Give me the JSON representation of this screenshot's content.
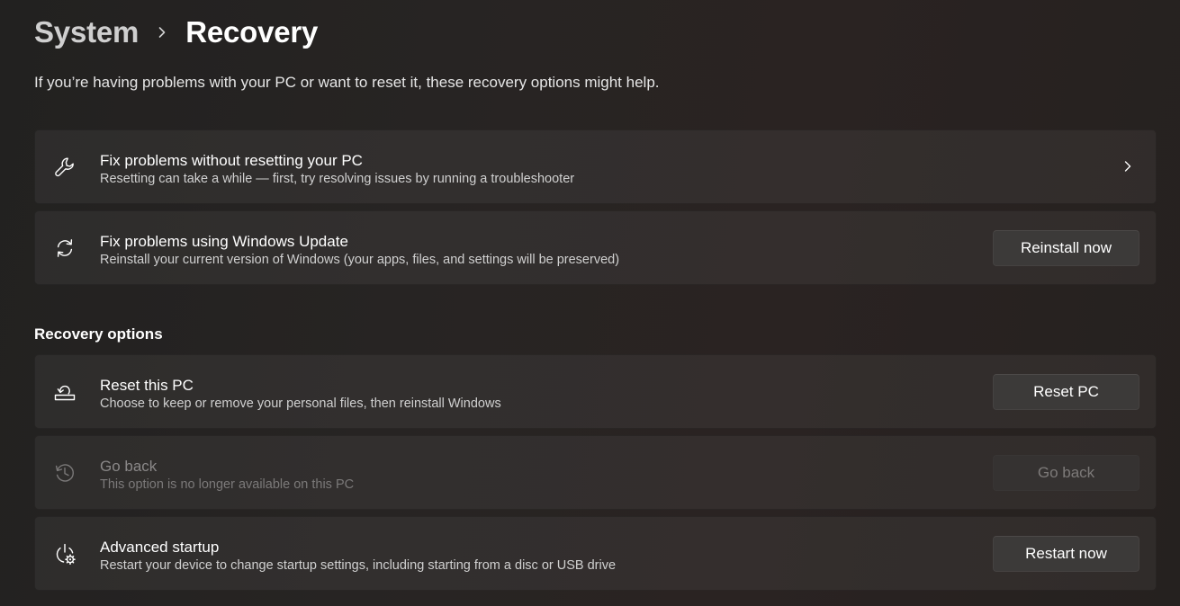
{
  "breadcrumb": {
    "parent": "System",
    "current": "Recovery",
    "separator_icon": "chevron-right-icon"
  },
  "intro": "If you’re having problems with your PC or want to reset it, these recovery options might help.",
  "cards": {
    "troubleshoot": {
      "icon": "wrench-icon",
      "title": "Fix problems without resetting your PC",
      "description": "Resetting can take a while — first, try resolving issues by running a troubleshooter",
      "action_icon": "chevron-right-icon"
    },
    "windows_update": {
      "icon": "sync-icon",
      "title": "Fix problems using Windows Update",
      "description": "Reinstall your current version of Windows (your apps, files, and settings will be preserved)",
      "button": "Reinstall now"
    }
  },
  "recovery_options": {
    "heading": "Recovery options",
    "reset": {
      "icon": "reset-pc-icon",
      "title": "Reset this PC",
      "description": "Choose to keep or remove your personal files, then reinstall Windows",
      "button": "Reset PC"
    },
    "go_back": {
      "icon": "history-icon",
      "title": "Go back",
      "description": "This option is no longer available on this PC",
      "button": "Go back",
      "disabled": true
    },
    "advanced_startup": {
      "icon": "power-gear-icon",
      "title": "Advanced startup",
      "description": "Restart your device to change startup settings, including starting from a disc or USB drive",
      "button": "Restart now"
    }
  },
  "colors": {
    "background": "#252221",
    "card": "#2f2c2b",
    "button": "#3c3a39",
    "text_primary": "#ffffff",
    "text_secondary": "#d0d0d0",
    "text_disabled": "#7b7979"
  }
}
